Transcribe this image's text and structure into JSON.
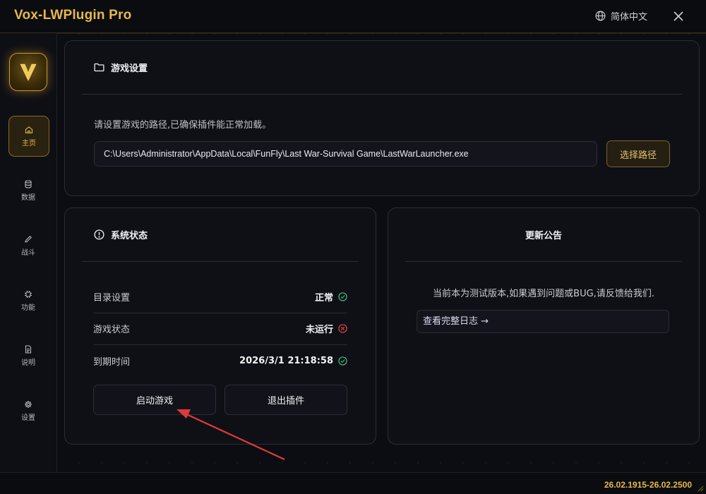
{
  "app": {
    "title": "Vox-LWPlugin Pro",
    "language": "简体中文"
  },
  "sidebar": {
    "items": [
      {
        "label": "主页",
        "icon": "home-icon",
        "active": true
      },
      {
        "label": "数据",
        "icon": "database-icon",
        "active": false
      },
      {
        "label": "战斗",
        "icon": "pen-icon",
        "active": false
      },
      {
        "label": "功能",
        "icon": "chip-icon",
        "active": false
      },
      {
        "label": "说明",
        "icon": "document-icon",
        "active": false
      },
      {
        "label": "设置",
        "icon": "gear-icon",
        "active": false
      }
    ]
  },
  "game_settings": {
    "title": "游戏设置",
    "description": "请设置游戏的路径,已确保插件能正常加载。",
    "path": "C:\\Users\\Administrator\\AppData\\Local\\FunFly\\Last War-Survival Game\\LastWarLauncher.exe",
    "select_path_label": "选择路径"
  },
  "system_status": {
    "title": "系统状态",
    "rows": [
      {
        "label": "目录设置",
        "value": "正常",
        "status": "ok"
      },
      {
        "label": "游戏状态",
        "value": "未运行",
        "status": "error"
      },
      {
        "label": "到期时间",
        "value": "2026/3/1 21:18:58",
        "status": "ok"
      }
    ],
    "start_game_label": "启动游戏",
    "exit_plugin_label": "退出插件"
  },
  "announcement": {
    "title": "更新公告",
    "message": "当前本为测试版本,如果遇到问题或BUG,请反馈给我们.",
    "log_link": "查看完整日志 →"
  },
  "footer": {
    "version": "26.02.1915-26.02.2500"
  },
  "colors": {
    "accent": "#e6b84a",
    "ok": "#3fbf7f",
    "error": "#e0414a",
    "annotation_arrow": "#e03a3a"
  }
}
